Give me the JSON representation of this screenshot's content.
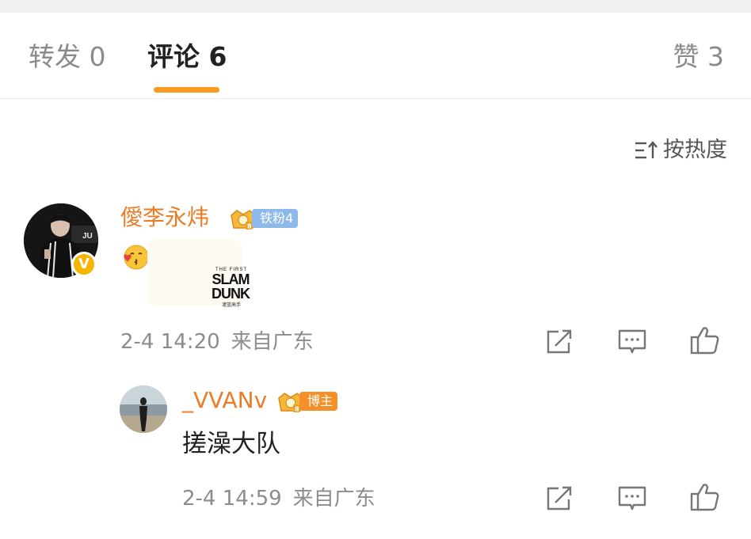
{
  "tabs": {
    "repost": "转发 0",
    "comment": "评论 6",
    "like": "赞 3"
  },
  "sort": {
    "label": "按热度",
    "icon": "sort-icon"
  },
  "colors": {
    "accent": "#f79a1e",
    "username": "#eb7b27",
    "verified": "#f6b500",
    "fan_badge": "#8db9ea",
    "author_badge": "#f58f2a",
    "meta_text": "#8c8c8c"
  },
  "comments": [
    {
      "username": "僾李永炜",
      "badge_label": "铁粉4",
      "verified": true,
      "content": {
        "emoji": "kiss-emoji",
        "sticker": {
          "top": "THE FIRST",
          "line1": "SLAM",
          "line2": "DUNK",
          "bottom": "灌篮高手"
        }
      },
      "time": "2-4 14:20",
      "location": "来自广东"
    },
    {
      "username": "_VVANv",
      "badge_label": "博主",
      "content": "搓澡大队",
      "time": "2-4 14:59",
      "location": "来自广东"
    }
  ]
}
